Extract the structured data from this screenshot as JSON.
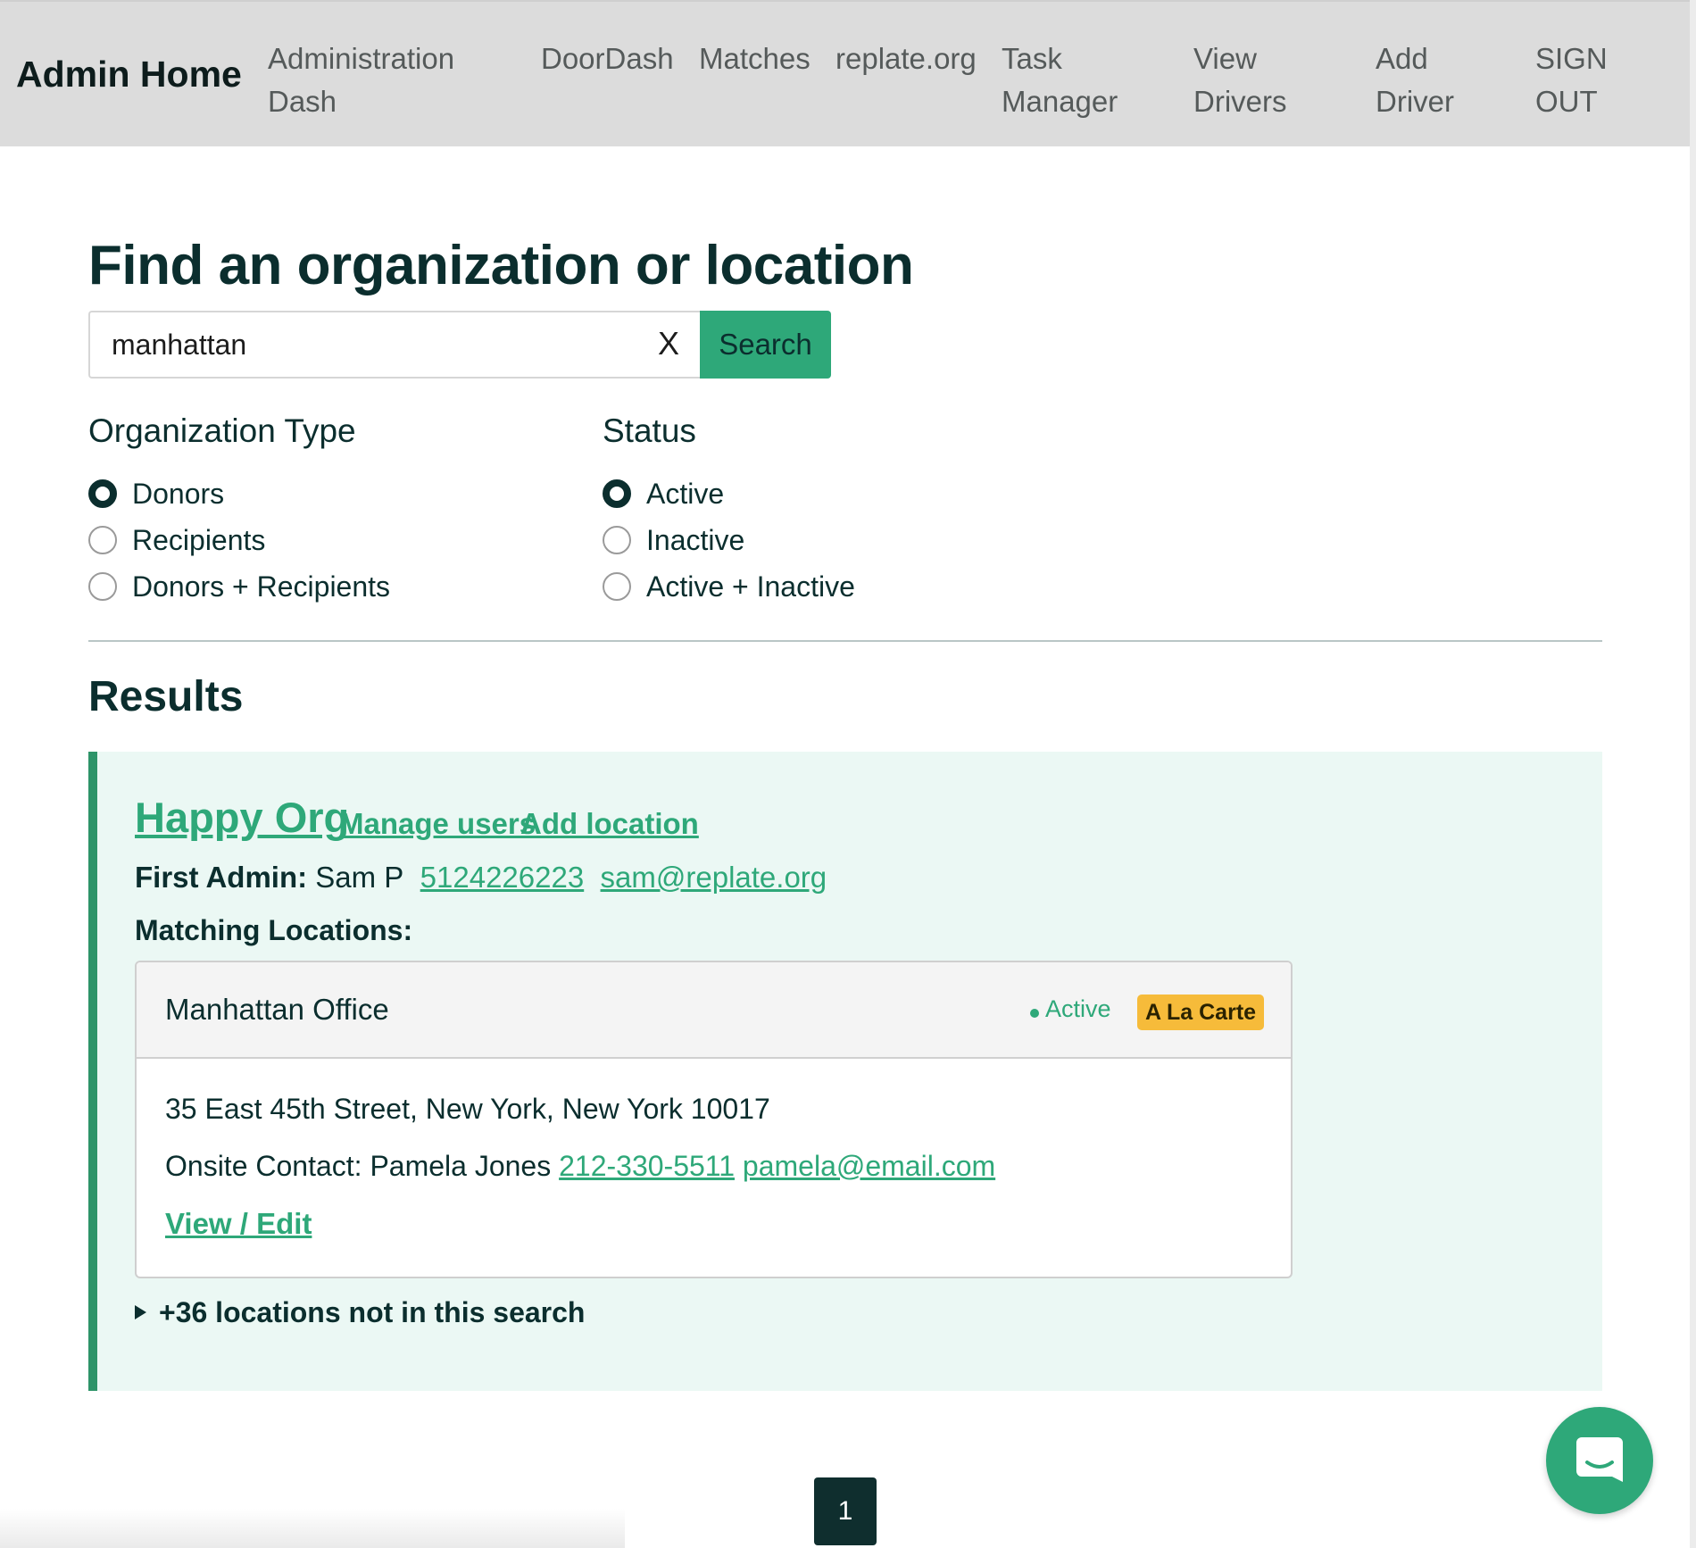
{
  "nav": {
    "brand": "Admin Home",
    "items": [
      {
        "line1": "Administration",
        "line2": "Dash"
      },
      {
        "line1": "DoorDash",
        "line2": ""
      },
      {
        "line1": "Matches",
        "line2": ""
      },
      {
        "line1": "replate.org",
        "line2": ""
      },
      {
        "line1": "Task",
        "line2": "Manager"
      },
      {
        "line1": "View",
        "line2": "Drivers"
      },
      {
        "line1": "Add",
        "line2": "Driver"
      },
      {
        "line1": "SIGN",
        "line2": "OUT"
      }
    ]
  },
  "main": {
    "title": "Find an organization or location",
    "search": {
      "value": "manhattan",
      "clear_label": "X",
      "button_label": "Search"
    },
    "filters": {
      "org_type": {
        "title": "Organization Type",
        "options": [
          "Donors",
          "Recipients",
          "Donors + Recipients"
        ],
        "selected": "Donors"
      },
      "status": {
        "title": "Status",
        "options": [
          "Active",
          "Inactive",
          "Active + Inactive"
        ],
        "selected": "Active"
      }
    },
    "results_title": "Results",
    "result": {
      "org_name": "Happy Org",
      "manage_users": "Manage users",
      "add_location": "Add location",
      "admin_label": "First Admin:",
      "admin_name": "Sam P",
      "admin_phone": "5124226223",
      "admin_email": "sam@replate.org",
      "matching_label": "Matching Locations:",
      "location": {
        "name": "Manhattan Office",
        "status": "Active",
        "badge": "A La Carte",
        "address": "35 East 45th Street, New York, New York 10017",
        "contact_label": "Onsite Contact:",
        "contact_name": "Pamela Jones",
        "contact_phone": "212-330-5511",
        "contact_email": "pamela@email.com",
        "edit_label": "View / Edit"
      },
      "more_locations": "+36 locations not in this search"
    },
    "pagination": {
      "current": "1"
    }
  },
  "colors": {
    "accent": "#2ea879",
    "dark": "#0b2e2e",
    "nav_bg": "#dcdcdc",
    "card_bg": "#ebf8f4",
    "badge": "#f6bb3a"
  },
  "icons": {
    "chat": "chat-bubble-icon",
    "disclosure": "triangle-right-icon"
  }
}
